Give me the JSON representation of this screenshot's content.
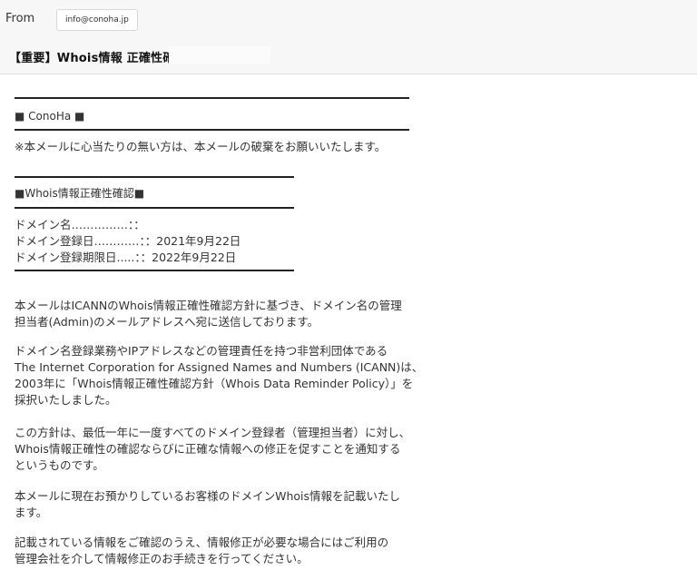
{
  "header": {
    "from_label": "From",
    "from_address": "info@conoha.jp",
    "subject": "【重要】Whois情報 正確性確認"
  },
  "body": {
    "brand": "■ ConoHa ■",
    "notice": "※本メールに心当たりの無い方は、本メールの破棄をお願いいたします。",
    "section_title": "■Whois情報正確性確認■",
    "domain_name": "ドメイン名……………：：",
    "registration_date": "ドメイン登録日…………：：2021年9月22日",
    "expiration_date": "ドメイン登録期限日.....：：2022年9月22日",
    "paragraphs": [
      [
        "本メールはICANNのWhois情報正確性確認方針に基づき、ドメイン名の管理",
        "担当者(Admin)のメールアドレスへ宛に送信しております。"
      ],
      [
        "ドメイン名登録業務やIPアドレスなどの管理責任を持つ非営利団体である",
        "The Internet Corporation for Assigned Names and Numbers (ICANN)は、",
        "2003年に「Whois情報正確性確認方針（Whois Data Reminder Policy）」を",
        "採択いたしました。"
      ],
      [
        "この方針は、最低一年に一度すべてのドメイン登録者（管理担当者）に対し、",
        "Whois情報正確性の確認ならびに正確な情報への修正を促すことを通知する",
        "というものです。"
      ],
      [
        "本メールに現在お預かりしているお客様のドメインWhois情報を記載いたし",
        "ます。"
      ],
      [
        "記載されている情報をご確認のうえ、情報修正が必要な場合にはご利用の",
        "管理会社を介して情報修正のお手続きを行ってください。"
      ]
    ]
  }
}
